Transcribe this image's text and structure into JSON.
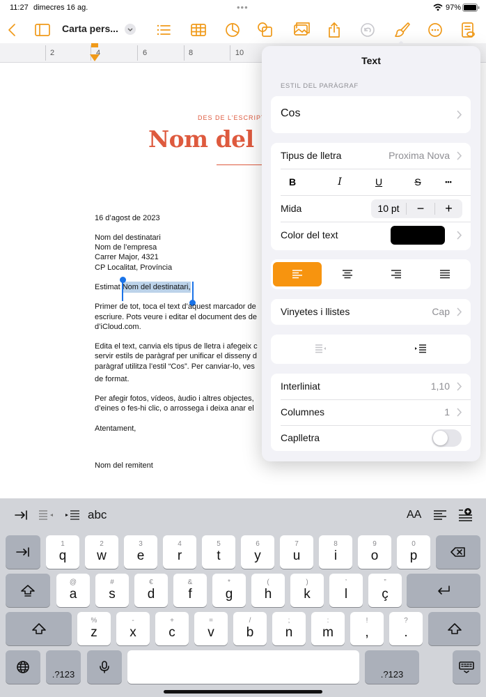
{
  "status": {
    "time": "11:27",
    "date": "dimecres 16 ag.",
    "battery": "97%"
  },
  "toolbar": {
    "doc_title": "Carta pers...",
    "accent": "#f09a1a"
  },
  "ruler": {
    "numbers": [
      "2",
      "4",
      "6",
      "8",
      "10"
    ]
  },
  "document": {
    "sender_label": "DES DE L’ESCRIPT",
    "sender_name": "Nom del re",
    "date": "16 d’agost de 2023",
    "address": [
      "Nom del destinatari",
      "Nom de l’empresa",
      "Carrer Major, 4321",
      "CP Localitat, Província"
    ],
    "greeting_prefix": "Estimat ",
    "greeting_selected": "Nom del destinatari,",
    "para1": [
      "Primer de tot, toca el text d’aquest marcador de",
      "escriure. Pots veure i editar el document des de",
      "d’iCloud.com."
    ],
    "para2": [
      "Edita el text, canvia els tipus de lletra i afegeix c",
      "servir estils de paràgraf per unificar el disseny d",
      "paràgraf utilitza l’estil “Cos”. Per canviar-lo, ves",
      "de format."
    ],
    "para3": [
      "Per afegir fotos, vídeos, àudio i altres objectes,",
      "d’eines o fes-hi clic, o arrossega i deixa anar el"
    ],
    "closing": "Atentament,",
    "signature": "Nom del remitent",
    "title_color": "#de5a3e"
  },
  "popover": {
    "title": "Text",
    "section_label": "ESTIL DEL PARÀGRAF",
    "paragraph_style": "Cos",
    "font_label": "Tipus de lletra",
    "font_value": "Proxima Nova",
    "style_buttons": [
      "B",
      "I",
      "U",
      "S",
      "•••"
    ],
    "size_label": "Mida",
    "size_value": "10 pt",
    "size_minus": "−",
    "size_plus": "+",
    "color_label": "Color del text",
    "color_value": "#000000",
    "bullets_label": "Vinyetes i llistes",
    "bullets_value": "Cap",
    "spacing_label": "Interliniat",
    "spacing_value": "1,10",
    "columns_label": "Columnes",
    "columns_value": "1",
    "dropcap_label": "Caplletra",
    "dropcap_on": false
  },
  "shortcut_bar": {
    "abc": "abc",
    "text_size": "AA"
  },
  "keyboard": {
    "row1": [
      [
        "1",
        "q"
      ],
      [
        "2",
        "w"
      ],
      [
        "3",
        "e"
      ],
      [
        "4",
        "r"
      ],
      [
        "5",
        "t"
      ],
      [
        "6",
        "y"
      ],
      [
        "7",
        "u"
      ],
      [
        "8",
        "i"
      ],
      [
        "9",
        "o"
      ],
      [
        "0",
        "p"
      ]
    ],
    "row2": [
      [
        "@",
        "a"
      ],
      [
        "#",
        "s"
      ],
      [
        "€",
        "d"
      ],
      [
        "&",
        "f"
      ],
      [
        "*",
        "g"
      ],
      [
        "(",
        "h"
      ],
      [
        ")",
        "k"
      ],
      [
        "’",
        "l"
      ],
      [
        "”",
        "ç"
      ]
    ],
    "row3": [
      [
        "%",
        "z"
      ],
      [
        "-",
        "x"
      ],
      [
        "+",
        "c"
      ],
      [
        "=",
        "v"
      ],
      [
        "/",
        "b"
      ],
      [
        ";",
        "n"
      ],
      [
        ":",
        "m"
      ],
      [
        "!",
        ","
      ],
      [
        "?",
        "."
      ]
    ],
    "num_label": ".?123"
  }
}
